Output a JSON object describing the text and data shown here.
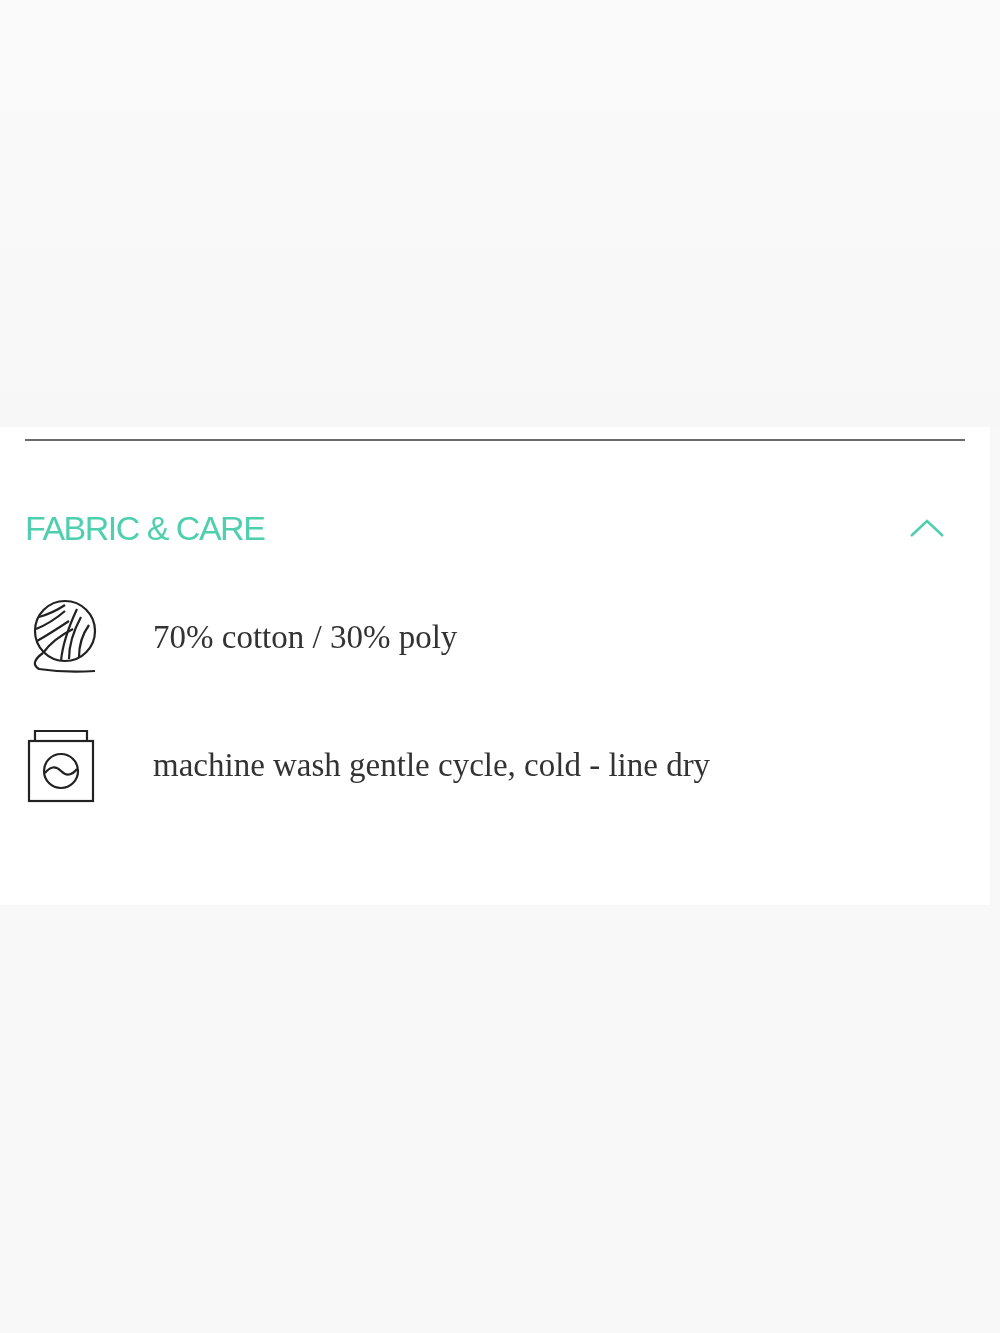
{
  "section": {
    "title": "FABRIC & CARE",
    "expanded": true,
    "items": [
      {
        "kind": "yarn",
        "text": "70% cotton / 30% poly"
      },
      {
        "kind": "washer",
        "text": "machine wash gentle cycle, cold - line dry"
      }
    ]
  }
}
